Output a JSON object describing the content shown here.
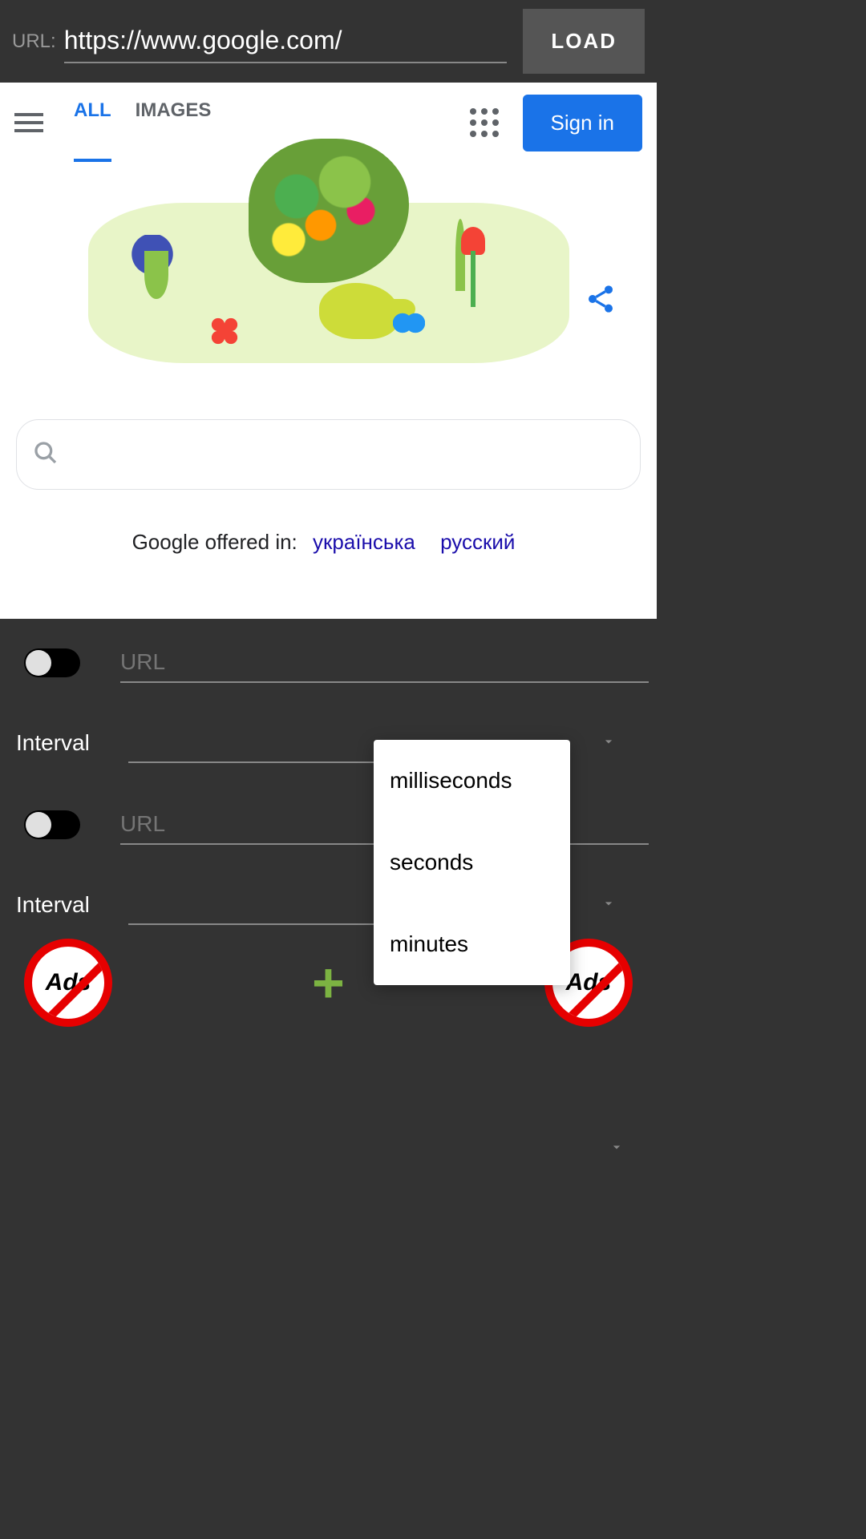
{
  "topbar": {
    "url_label": "URL:",
    "url_value": "https://www.google.com/",
    "load_label": "LOAD"
  },
  "google": {
    "tabs": {
      "all": "ALL",
      "images": "IMAGES"
    },
    "signin": "Sign in",
    "offered_in": "Google offered in:",
    "lang1": "українська",
    "lang2": "русский"
  },
  "panel": {
    "url_placeholder": "URL",
    "interval_label": "Interval",
    "ads_text": "Ads"
  },
  "popup": {
    "opt1": "milliseconds",
    "opt2": "seconds",
    "opt3": "minutes"
  }
}
